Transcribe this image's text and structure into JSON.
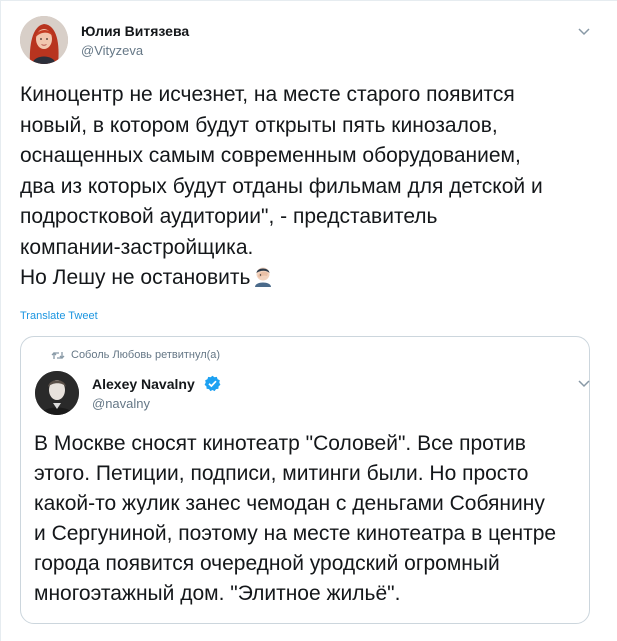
{
  "tweet": {
    "author": {
      "name": "Юлия Витязева",
      "handle": "@Vityzeva"
    },
    "text_lines": [
      "Киноцентр не исчезнет, на месте старого появится",
      "новый, в котором будут открыты пять кинозалов,",
      "оснащенных самым современным оборудованием,",
      "два из которых будут отданы фильмам для детской и",
      "подростковой аудитории\", - представитель",
      "компании-застройщика.",
      "Но Лешу не остановить"
    ],
    "trailing_emoji": "face-palm-emoji",
    "translate_label": "Translate Tweet",
    "menu_icon": "chevron-down-icon"
  },
  "quoted": {
    "retweet_label": "Соболь Любовь ретвитнул(а)",
    "retweet_icon": "retweet-icon",
    "author": {
      "name": "Alexey Navalny",
      "handle": "@navalny",
      "verified_icon": "verified-badge-icon"
    },
    "text_lines": [
      "В Москве сносят кинотеатр \"Соловей\". Все против",
      "этого. Петиции, подписи, митинги были. Но просто",
      "какой-то жулик занес чемодан с деньгами Собянину",
      "и Сергуниной, поэтому на месте кинотеатра в центре",
      "города появится очередной уродский огромный",
      "многоэтажный дом. \"Элитное жильё\"."
    ]
  },
  "colors": {
    "text": "#14171a",
    "secondary": "#657786",
    "link": "#1b95e0",
    "border": "#ccd6dd",
    "verified": "#1da1f2"
  }
}
